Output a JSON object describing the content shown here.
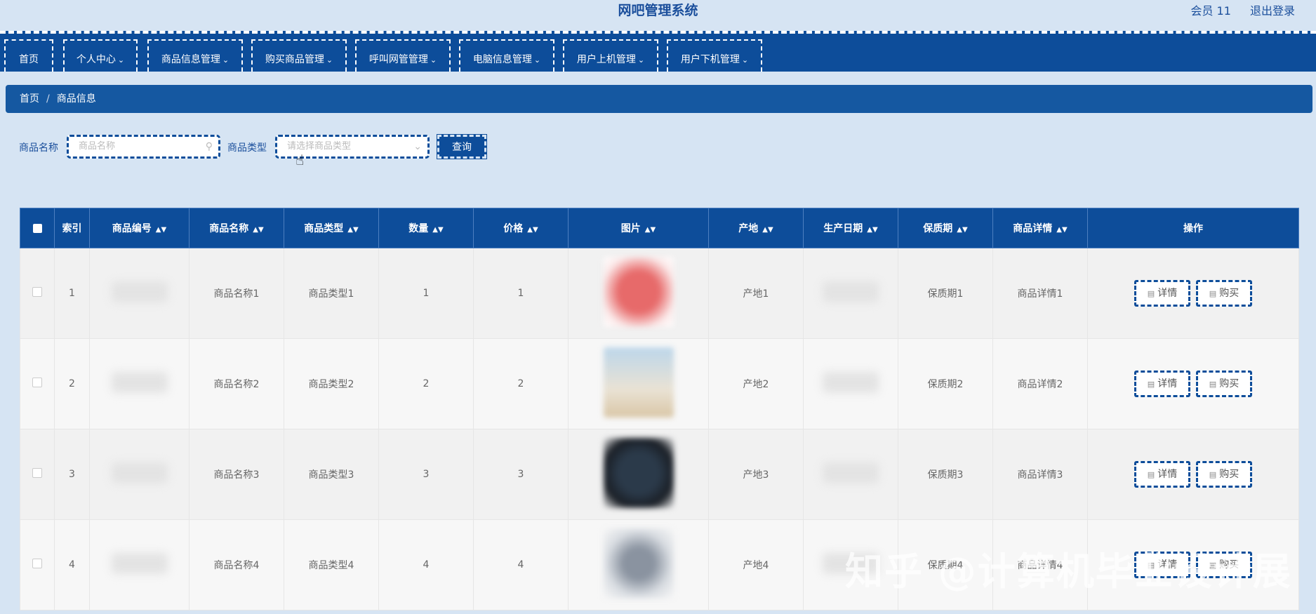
{
  "header": {
    "title": "网吧管理系统",
    "member": "会员 11",
    "logout": "退出登录"
  },
  "nav": {
    "items": [
      {
        "label": "首页",
        "dropdown": false
      },
      {
        "label": "个人中心",
        "dropdown": true
      },
      {
        "label": "商品信息管理",
        "dropdown": true
      },
      {
        "label": "购买商品管理",
        "dropdown": true
      },
      {
        "label": "呼叫网管管理",
        "dropdown": true
      },
      {
        "label": "电脑信息管理",
        "dropdown": true
      },
      {
        "label": "用户上机管理",
        "dropdown": true
      },
      {
        "label": "用户下机管理",
        "dropdown": true
      }
    ]
  },
  "breadcrumb": {
    "home": "首页",
    "sep": "/",
    "current": "商品信息"
  },
  "search": {
    "name_label": "商品名称",
    "name_placeholder": "商品名称",
    "type_label": "商品类型",
    "type_placeholder": "请选择商品类型",
    "query_button": "查询"
  },
  "table": {
    "headers": [
      "索引",
      "商品编号",
      "商品名称",
      "商品类型",
      "数量",
      "价格",
      "图片",
      "产地",
      "生产日期",
      "保质期",
      "商品详情",
      "操作"
    ],
    "rows": [
      {
        "index": "1",
        "name": "商品名称1",
        "type": "商品类型1",
        "qty": "1",
        "price": "1",
        "origin": "产地1",
        "shelf": "保质期1",
        "detail": "商品详情1"
      },
      {
        "index": "2",
        "name": "商品名称2",
        "type": "商品类型2",
        "qty": "2",
        "price": "2",
        "origin": "产地2",
        "shelf": "保质期2",
        "detail": "商品详情2"
      },
      {
        "index": "3",
        "name": "商品名称3",
        "type": "商品类型3",
        "qty": "3",
        "price": "3",
        "origin": "产地3",
        "shelf": "保质期3",
        "detail": "商品详情3"
      },
      {
        "index": "4",
        "name": "商品名称4",
        "type": "商品类型4",
        "qty": "4",
        "price": "4",
        "origin": "产地4",
        "shelf": "保质期4",
        "detail": "商品详情4"
      }
    ],
    "actions": {
      "detail": "详情",
      "buy": "购买"
    }
  },
  "watermark": "知乎 @计算机毕业设计展",
  "colors": {
    "primary": "#0d4d9a",
    "page_bg": "#d6e4f3"
  },
  "icons": {
    "search": "search-icon",
    "dropdown": "chevron-down-icon",
    "sort": "sort-icon",
    "doc": "document-icon"
  }
}
